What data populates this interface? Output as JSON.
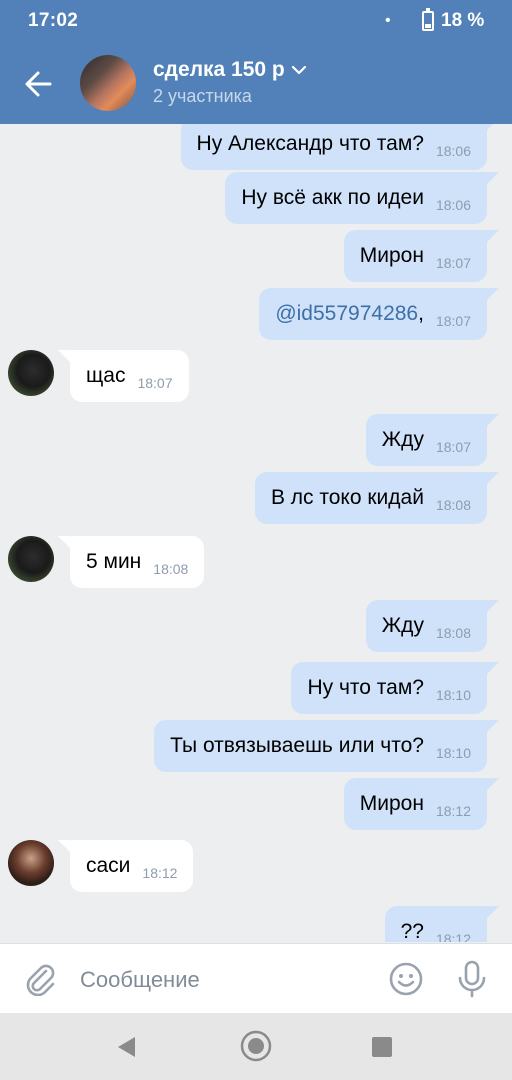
{
  "status": {
    "time": "17:02",
    "dot": "•",
    "battery": "18 %"
  },
  "header": {
    "title": "сделка 150 р",
    "subtitle": "2 участника"
  },
  "messages": [
    {
      "dir": "out",
      "text": "Ну Александр что там?",
      "time": "18:06"
    },
    {
      "dir": "out",
      "text": "Ну всё акк по идеи",
      "time": "18:06"
    },
    {
      "dir": "out",
      "text": "Мирон",
      "time": "18:07"
    },
    {
      "dir": "out",
      "mention": "@id557974286",
      "text": ",",
      "time": "18:07"
    },
    {
      "dir": "in",
      "text": "щас",
      "time": "18:07"
    },
    {
      "dir": "out",
      "text": "Жду",
      "time": "18:07"
    },
    {
      "dir": "out",
      "text": "В лс токо кидай",
      "time": "18:08"
    },
    {
      "dir": "in",
      "text": "5 мин",
      "time": "18:08"
    },
    {
      "dir": "out",
      "text": "Жду",
      "time": "18:08"
    },
    {
      "dir": "out",
      "text": "Ну что там?",
      "time": "18:10"
    },
    {
      "dir": "out",
      "text": "Ты отвязываешь или что?",
      "time": "18:10"
    },
    {
      "dir": "out",
      "text": "Мирон",
      "time": "18:12"
    },
    {
      "dir": "in",
      "text": "саси",
      "time": "18:12"
    },
    {
      "dir": "out",
      "text": "??",
      "time": "18:12"
    }
  ],
  "composer": {
    "placeholder": "Сообщение"
  },
  "icons": {
    "back": "arrow-left-icon",
    "chevron": "chevron-down-icon",
    "attach": "paperclip-icon",
    "emoji": "smile-icon",
    "mic": "microphone-icon"
  },
  "colors": {
    "header": "#5181b8",
    "outgoing_bubble": "#cfe2f9",
    "incoming_bubble": "#ffffff",
    "background": "#edeef0",
    "mention": "#3d6fa8"
  }
}
